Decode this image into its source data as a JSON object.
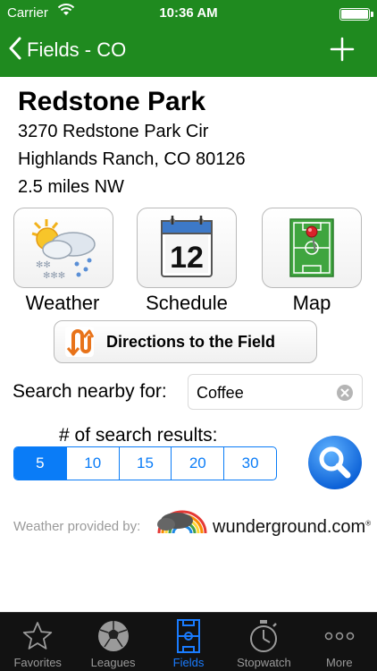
{
  "status": {
    "carrier": "Carrier",
    "time": "10:36 AM"
  },
  "nav": {
    "back_label": "Fields - CO"
  },
  "field": {
    "name": "Redstone Park",
    "address_line1": "3270 Redstone Park Cir",
    "address_line2": "Highlands Ranch, CO 80126",
    "distance": "2.5 miles NW"
  },
  "tiles": {
    "weather_label": "Weather",
    "schedule_label": "Schedule",
    "schedule_day": "12",
    "map_label": "Map"
  },
  "directions_label": "Directions to the Field",
  "search": {
    "label": "Search nearby for:",
    "value": "Coffee"
  },
  "results": {
    "label": "# of search results:",
    "options": [
      "5",
      "10",
      "15",
      "20",
      "30"
    ],
    "selected": "5"
  },
  "attribution": {
    "provided_by": "Weather provided by:",
    "brand": "wunderground.com"
  },
  "tabbar": {
    "items": [
      {
        "label": "Favorites",
        "icon": "star-icon"
      },
      {
        "label": "Leagues",
        "icon": "soccer-ball-icon"
      },
      {
        "label": "Fields",
        "icon": "field-icon"
      },
      {
        "label": "Stopwatch",
        "icon": "stopwatch-icon"
      },
      {
        "label": "More",
        "icon": "more-icon"
      }
    ],
    "active": "Fields"
  },
  "colors": {
    "nav_green": "#1f8a1f",
    "ios_blue": "#0a7cf7",
    "tab_active": "#1a7cff"
  }
}
